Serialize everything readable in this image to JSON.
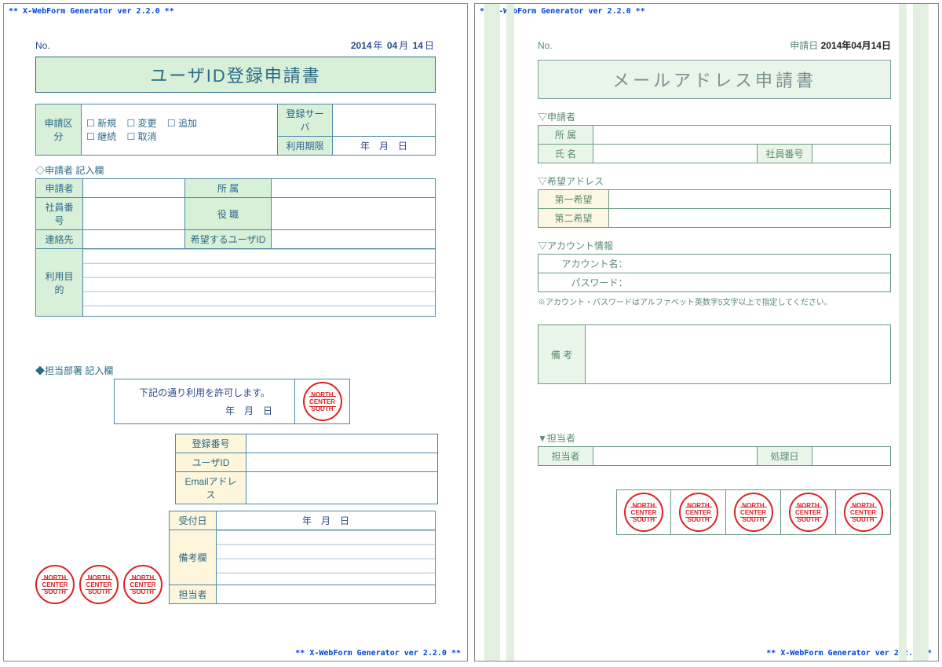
{
  "app": {
    "header": "** X-WebForm Generator ver 2.2.0 **",
    "footer": "** X-WebForm Generator ver 2.2.0 **"
  },
  "stamp": {
    "top": "NORTH",
    "mid": "CENTER",
    "bot": "SOUTH"
  },
  "form1": {
    "no_label": "No.",
    "date": {
      "y": "2014",
      "ysfx": "年",
      "m": "04",
      "msfx": "月",
      "d": "14",
      "dsfx": "日"
    },
    "title": "ユーザID登録申請書",
    "type_label": "申請区分",
    "types": {
      "a": "新規",
      "b": "変更",
      "c": "追加",
      "d": "継続",
      "e": "取消"
    },
    "server_label": "登録サーバ",
    "period_label": "利用期限",
    "period_fmt": "年　月　日",
    "applicant_cap": "◇申請者 記入欄",
    "applicant": "申請者",
    "affil": "所 属",
    "empno": "社員番号",
    "role": "役 職",
    "contact": "連絡先",
    "wanted_id": "希望するユーザID",
    "purpose": "利用目的",
    "dept_cap": "◆担当部署 記入欄",
    "approval_text": "下記の通り利用を許可します。",
    "approval_date": "年　月　日",
    "reg_no": "登録番号",
    "user_id": "ユーザID",
    "email": "Emailアドレス",
    "recv_date": "受付日",
    "recv_date_fmt": "年　月　日",
    "remarks": "備考欄",
    "assignee": "担当者"
  },
  "form2": {
    "no_label": "No.",
    "app_date_label": "申請日",
    "app_date": "2014年04月14日",
    "title": "メールアドレス申請書",
    "applicant_cap": "▽申請者",
    "affil": "所 属",
    "name": "氏 名",
    "empno": "社員番号",
    "wish_cap": "▽希望アドレス",
    "wish1": "第一希望",
    "wish2": "第二希望",
    "acct_cap": "▽アカウント情報",
    "acct_name": "アカウント名：",
    "password": "パスワード：",
    "note": "※アカウント・パスワードはアルファベット英数字5文字以上で指定してください。",
    "remarks": "備 考",
    "staff_cap": "▼担当者",
    "staff": "担当者",
    "proc_date": "処理日"
  }
}
